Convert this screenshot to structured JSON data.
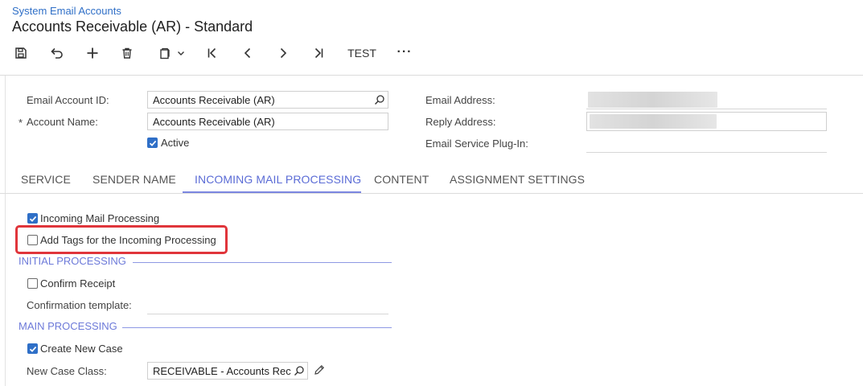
{
  "header": {
    "breadcrumb": "System Email Accounts",
    "title": "Accounts Receivable (AR) - Standard"
  },
  "toolbar": {
    "items": [
      {
        "name": "save-icon"
      },
      {
        "name": "undo-icon"
      },
      {
        "name": "add-icon"
      },
      {
        "name": "delete-icon"
      },
      {
        "name": "copy-paste-icon"
      },
      {
        "name": "first-record-icon"
      },
      {
        "name": "previous-record-icon"
      },
      {
        "name": "next-record-icon"
      },
      {
        "name": "last-record-icon"
      },
      {
        "name": "more-icon"
      }
    ],
    "test_label": "TEST",
    "more_label": "···"
  },
  "summary": {
    "email_account_id_label": "Email Account ID:",
    "email_account_id_value": "Accounts Receivable (AR)",
    "account_name_required": "*",
    "account_name_label": "Account Name:",
    "account_name_value": "Accounts Receivable (AR)",
    "active_label": "Active",
    "active_checked": true,
    "email_address_label": "Email Address:",
    "reply_address_label": "Reply Address:",
    "email_service_plugin_label": "Email Service Plug-In:"
  },
  "tabs": [
    {
      "label": "SERVICE",
      "active": false
    },
    {
      "label": "SENDER NAME",
      "active": false
    },
    {
      "label": "INCOMING MAIL PROCESSING",
      "active": true
    },
    {
      "label": "CONTENT",
      "active": false
    },
    {
      "label": "ASSIGNMENT SETTINGS",
      "active": false
    }
  ],
  "incoming": {
    "incoming_mail_processing_label": "Incoming Mail Processing",
    "incoming_mail_processing_checked": true,
    "add_tags_label": "Add Tags for the Incoming Processing",
    "add_tags_checked": false,
    "initial_processing_title": "INITIAL PROCESSING",
    "confirm_receipt_label": "Confirm Receipt",
    "confirm_receipt_checked": false,
    "confirmation_template_label": "Confirmation template:",
    "main_processing_title": "MAIN PROCESSING",
    "create_new_case_label": "Create New Case",
    "create_new_case_checked": true,
    "new_case_class_label": "New Case Class:",
    "new_case_class_value": "RECEIVABLE - Accounts Rec"
  },
  "colors": {
    "accent": "#2f6fc7",
    "tab_active": "#5b6cd6",
    "section_title": "#6d7ad9",
    "highlight": "#e0353b"
  }
}
